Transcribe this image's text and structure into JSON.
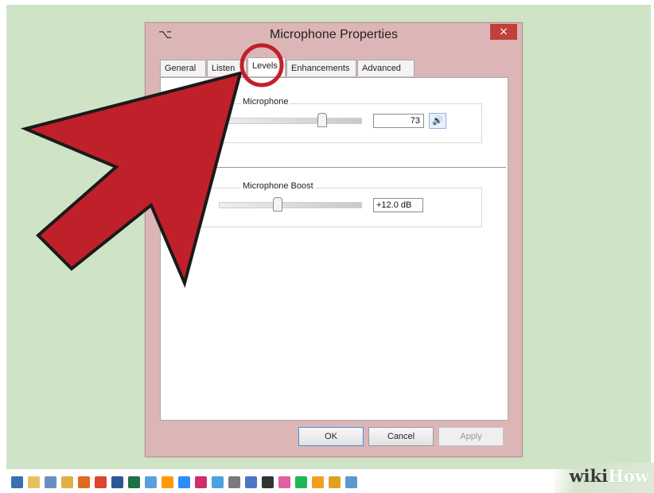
{
  "dialog": {
    "title": "Microphone Properties",
    "close_label": "×",
    "tabs": [
      {
        "label": "General"
      },
      {
        "label": "Listen"
      },
      {
        "label": "Levels"
      },
      {
        "label": "Enhancements"
      },
      {
        "label": "Advanced"
      }
    ],
    "active_tab": "Levels",
    "microphone_group": {
      "label": "Microphone",
      "value": "73",
      "slider_level_percent": 73
    },
    "boost_group": {
      "label": "Microphone Boost",
      "value": "+12.0 dB",
      "slider_level_percent": 40
    },
    "buttons": {
      "ok": "OK",
      "cancel": "Cancel",
      "apply": "Apply"
    }
  },
  "watermark": {
    "wiki": "wiki",
    "how": "How"
  },
  "colors": {
    "desktop": "#cfe3c7",
    "arrow": "#c0202a",
    "highlight_circle": "#c0202a",
    "title_bar": "#dcb6b6",
    "close_button": "#c0403a"
  },
  "taskbar": {
    "icons": [
      "start-icon",
      "file-explorer-icon",
      "app-icon",
      "folder-icon",
      "firefox-icon",
      "chrome-icon",
      "word-icon",
      "excel-icon",
      "app-icon",
      "illustrator-icon",
      "photoshop-icon",
      "indesign-icon",
      "lightroom-icon",
      "app-icon",
      "app-icon",
      "app-icon",
      "itunes-icon",
      "spotify-icon",
      "app-icon",
      "app-icon",
      "app-icon"
    ]
  }
}
